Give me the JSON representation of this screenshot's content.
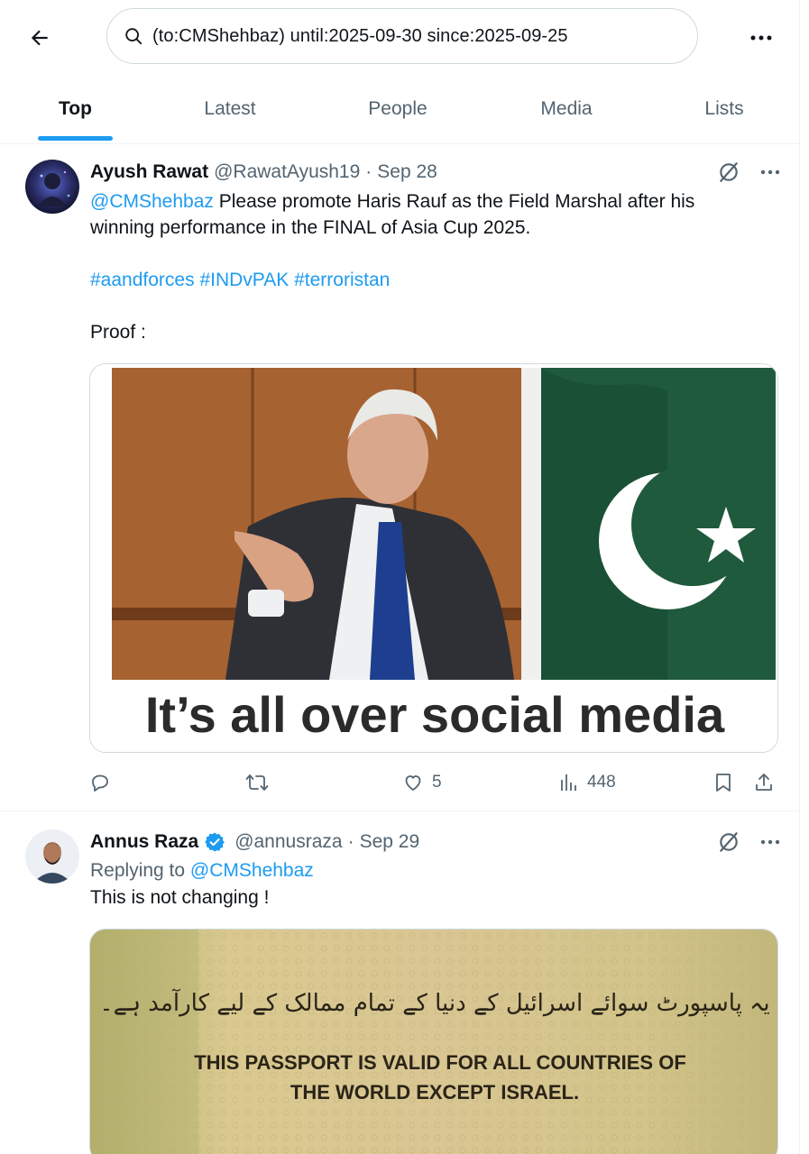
{
  "search": {
    "query": "(to:CMShehbaz) until:2025-09-30 since:2025-09-25"
  },
  "tabs": [
    {
      "label": "Top",
      "active": true
    },
    {
      "label": "Latest",
      "active": false
    },
    {
      "label": "People",
      "active": false
    },
    {
      "label": "Media",
      "active": false
    },
    {
      "label": "Lists",
      "active": false
    }
  ],
  "tweets": [
    {
      "name": "Ayush Rawat",
      "handle": "@RawatAyush19",
      "separator": "·",
      "date": "Sep 28",
      "mention": "@CMShehbaz",
      "text_line1": " Please promote Haris Rauf as the Field Marshal after his",
      "text_line2": "winning performance in the FINAL of Asia Cup 2025.",
      "hashtags": [
        "#aandforces",
        "#INDvPAK",
        "#terroristan"
      ],
      "proof_label": "Proof :",
      "media_caption": "It’s all over social media",
      "likes": "5",
      "views": "448"
    },
    {
      "name": "Annus Raza",
      "handle": "@annusraza",
      "separator": "·",
      "date": "Sep 29",
      "replying_prefix": "Replying to ",
      "replying_to": "@CMShehbaz",
      "text": "This is not changing !",
      "media_urdu": "یہ پاسپورٹ سوائے اسرائیل کے دنیا کے تمام ممالک کے لیے کارآمد ہے۔",
      "media_line1": "THIS PASSPORT IS VALID FOR ALL COUNTRIES OF",
      "media_line2": "THE WORLD EXCEPT ISRAEL."
    }
  ],
  "colors": {
    "accent": "#1d9bf0",
    "secondary_text": "#536471",
    "border": "#eff3f4"
  },
  "icons": [
    "back-arrow-icon",
    "search-icon",
    "more-icon",
    "grok-icon",
    "reply-icon",
    "retweet-icon",
    "like-icon",
    "views-icon",
    "bookmark-icon",
    "share-icon",
    "verified-badge-icon"
  ]
}
